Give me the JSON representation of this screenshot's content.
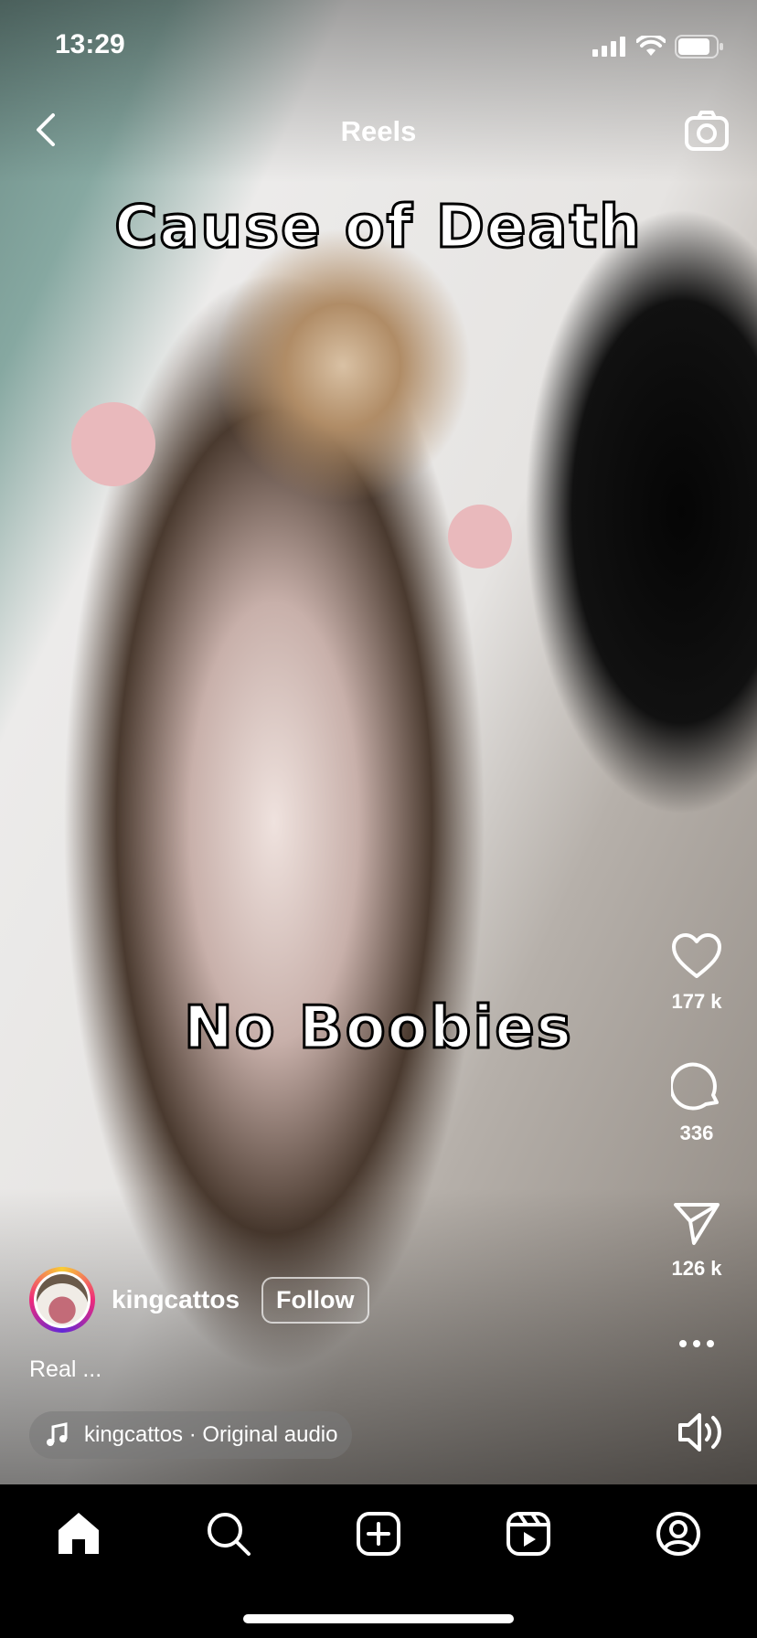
{
  "status_bar": {
    "time": "13:29"
  },
  "nav": {
    "title": "Reels"
  },
  "video": {
    "caption_top": "Cause of Death",
    "caption_bottom": "No Boobies"
  },
  "actions": {
    "likes": "177 k",
    "comments": "336",
    "shares": "126 k"
  },
  "post": {
    "username": "kingcattos",
    "follow_label": "Follow",
    "description": "Real ...",
    "audio": "kingcattos · Original audio"
  },
  "tabs": [
    "home",
    "search",
    "create",
    "reels",
    "profile"
  ],
  "colors": {
    "background": "#000000",
    "text": "#ffffff"
  }
}
